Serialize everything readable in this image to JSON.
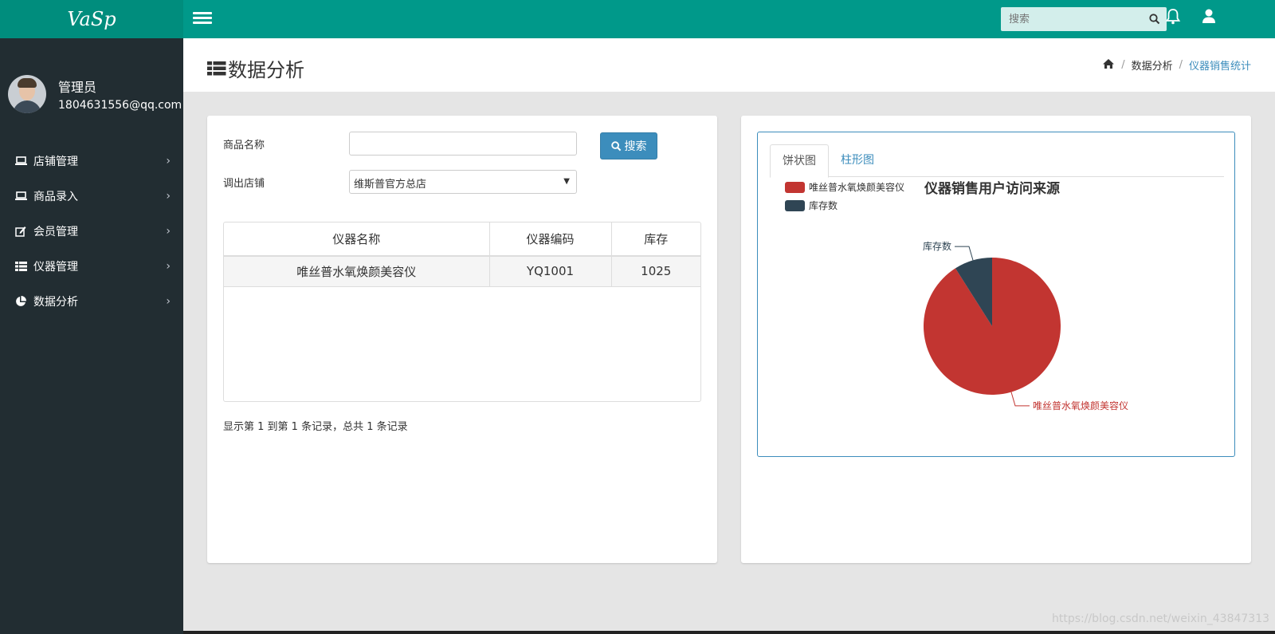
{
  "app": {
    "logo": "VaSp"
  },
  "user": {
    "name": "管理员",
    "email": "1804631556@qq.com"
  },
  "sidebar": {
    "items": [
      {
        "label": "店铺管理",
        "icon": "laptop-icon"
      },
      {
        "label": "商品录入",
        "icon": "laptop-icon"
      },
      {
        "label": "会员管理",
        "icon": "edit-icon"
      },
      {
        "label": "仪器管理",
        "icon": "list-icon"
      },
      {
        "label": "数据分析",
        "icon": "pie-chart-icon"
      }
    ]
  },
  "header": {
    "search_placeholder": "搜索"
  },
  "page": {
    "title": "数据分析"
  },
  "breadcrumb": {
    "items": [
      "数据分析",
      "仪器销售统计"
    ]
  },
  "form": {
    "product_name_label": "商品名称",
    "product_name_value": "",
    "store_label": "调出店铺",
    "store_selected": "维斯普官方总店",
    "search_button": "搜索"
  },
  "table": {
    "headers": [
      "仪器名称",
      "仪器编码",
      "库存"
    ],
    "rows": [
      [
        "唯丝普水氧焕颜美容仪",
        "YQ1001",
        "1025"
      ]
    ]
  },
  "pagination": {
    "info": "显示第 1 到第 1 条记录，总共 1 条记录"
  },
  "chart_tabs": [
    "饼状图",
    "柱形图"
  ],
  "chart_data": {
    "type": "pie",
    "title": "仪器销售用户访问来源",
    "legend_position": "top-left",
    "slices": [
      {
        "name": "唯丝普水氧焕颜美容仪",
        "value": 0.91,
        "color": "#c23531"
      },
      {
        "name": "库存数",
        "value": 0.09,
        "color": "#2f4554"
      }
    ]
  },
  "watermark": "https://blog.csdn.net/weixin_43847313",
  "colors": {
    "primary": "#00998a",
    "sidebar": "#222d32",
    "accent": "#3c8dbc"
  }
}
